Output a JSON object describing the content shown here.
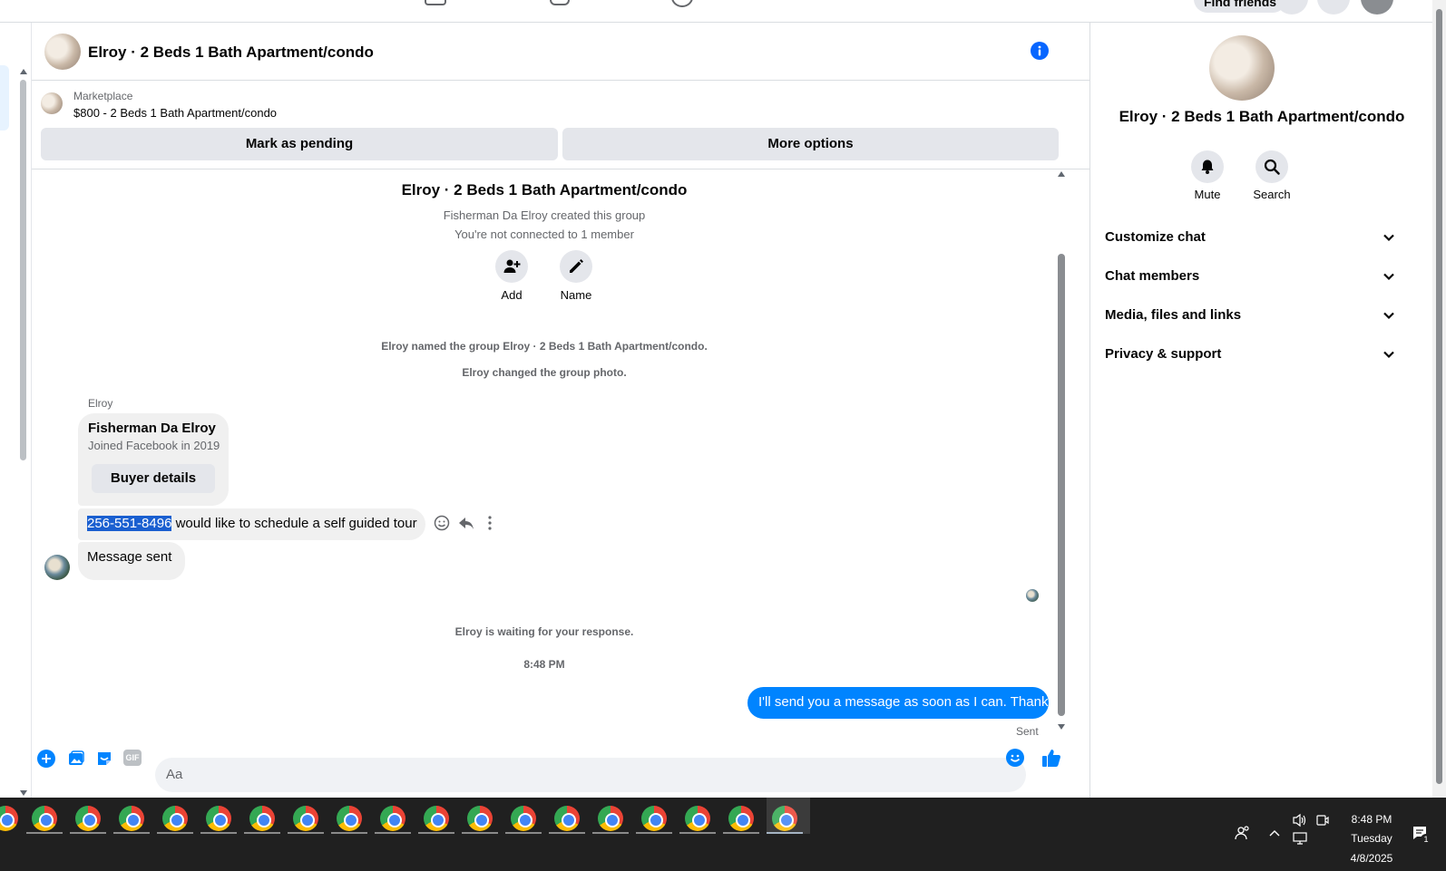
{
  "top_nav": {
    "find_friends_label": "Find friends"
  },
  "chat_header": {
    "title": "Elroy · 2 Beds 1 Bath Apartment/condo"
  },
  "marketplace": {
    "label": "Marketplace",
    "listing": "$800 - 2 Beds 1 Bath Apartment/condo",
    "mark_pending_label": "Mark as pending",
    "more_options_label": "More options"
  },
  "thread": {
    "group_title": "Elroy · 2 Beds 1 Bath Apartment/condo",
    "created_note": "Fisherman Da Elroy created this group",
    "connected_note": "You're not connected to 1 member",
    "add_label": "Add",
    "name_label": "Name",
    "named_event": "Elroy named the group Elroy · 2 Beds 1 Bath Apartment/condo.",
    "photo_event": "Elroy changed the group photo.",
    "sender_name": "Elroy",
    "profile_card": {
      "name": "Fisherman Da Elroy",
      "joined": "Joined Facebook in 2019",
      "button_label": "Buyer details"
    },
    "phone_highlight": "256-551-8496",
    "message_rest": " would like to schedule a self guided tour",
    "message_sent": "Message sent",
    "waiting_note": "Elroy is waiting for your response.",
    "timestamp": "8:48 PM",
    "my_reply": "I'll send you a message as soon as I can. Thanks",
    "sent_status": "Sent"
  },
  "composer": {
    "placeholder": "Aa",
    "gif_label": "GIF"
  },
  "right_panel": {
    "title": "Elroy · 2 Beds 1 Bath Apartment/condo",
    "mute_label": "Mute",
    "search_label": "Search",
    "sections": [
      "Customize chat",
      "Chat members",
      "Media, files and links",
      "Privacy & support"
    ]
  },
  "taskbar": {
    "time": "8:48 PM",
    "day": "Tuesday",
    "date": "4/8/2025",
    "notification_count": "1"
  },
  "colors": {
    "accent": "#0084ff",
    "taskbar": "#202020",
    "bubble": "#f0f0f0"
  },
  "icons": [
    "info-icon",
    "add-person-icon",
    "pencil-icon",
    "emoji-icon",
    "reply-icon",
    "more-icon",
    "plus-icon",
    "gallery-icon",
    "sticker-icon",
    "gif-icon",
    "emoji-icon",
    "thumbs-up-icon",
    "bell-icon",
    "search-icon",
    "chevron-down-icon",
    "chrome-icon"
  ]
}
